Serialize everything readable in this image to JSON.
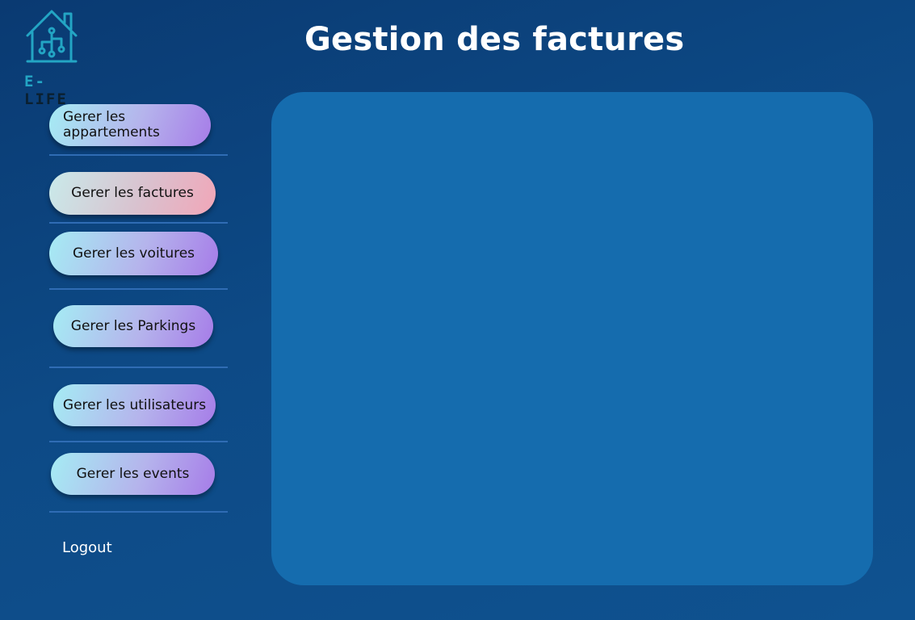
{
  "brand": {
    "prefix": "E-",
    "name": "LIFE"
  },
  "page_title": "Gestion des factures",
  "nav": {
    "apartments_label": "Gerer les appartements",
    "invoices_label": "Gerer les factures",
    "cars_label": "Gerer les voitures",
    "parkings_label": "Gerer les Parkings",
    "users_label": "Gerer les utilisateurs",
    "events_label": "Gerer les events"
  },
  "logout_label": "Logout",
  "colors": {
    "background": "#0d4a86",
    "panel": "#156cae",
    "button_gradient_start": "#a5ecf4",
    "button_gradient_end": "#a67ce8",
    "active_gradient_end": "#f1a6b8",
    "logo_accent": "#23a5c4"
  },
  "icons": {
    "logo": "smart-home-icon"
  }
}
